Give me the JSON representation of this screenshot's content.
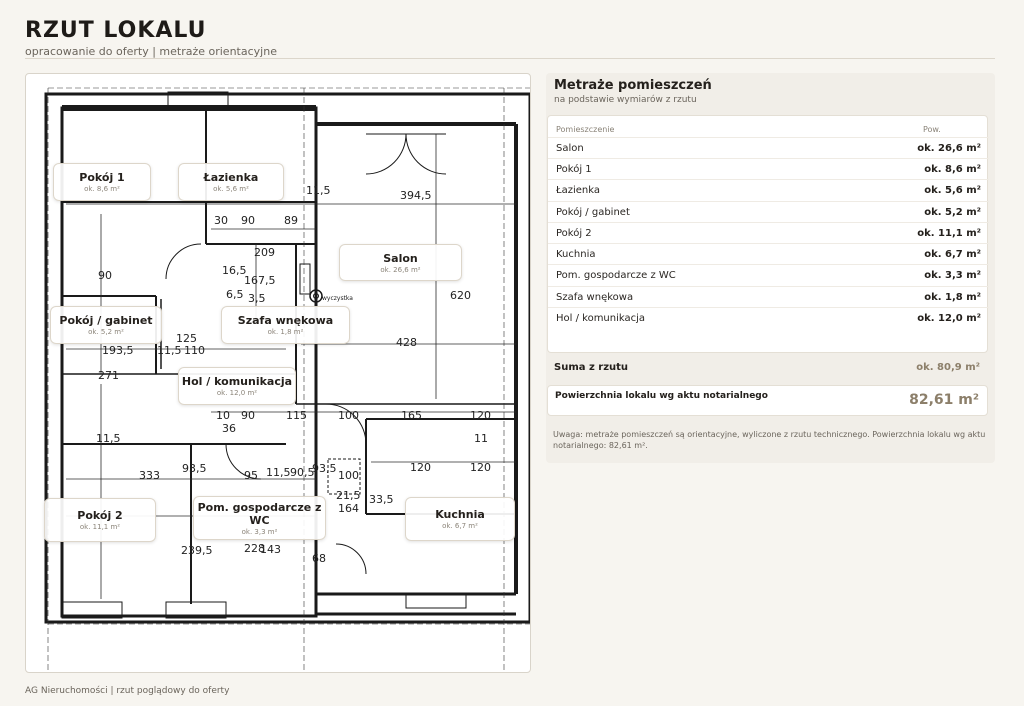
{
  "header": {
    "title": "RZUT LOKALU",
    "subtitle": "opracowanie do oferty | metraże orientacyjne"
  },
  "plan": {
    "rooms": [
      {
        "name": "Pokój 1",
        "area": "ok. 8,6 m²"
      },
      {
        "name": "Łazienka",
        "area": "ok. 5,6 m²"
      },
      {
        "name": "Salon",
        "area": "ok. 26,6 m²"
      },
      {
        "name": "Pokój / gabinet",
        "area": "ok. 5,2 m²"
      },
      {
        "name": "Szafa wnękowa",
        "area": "ok. 1,8 m²"
      },
      {
        "name": "Hol / komunikacja",
        "area": "ok. 12,0 m²"
      },
      {
        "name": "Pokój 2",
        "area": "ok. 11,1 m²"
      },
      {
        "name": "Pom. gospodarcze z WC",
        "area": "ok. 3,3 m²"
      },
      {
        "name": "Kuchnia",
        "area": "ok. 6,7 m²"
      }
    ],
    "dimensions": [
      "394,5",
      "11,5",
      "30",
      "90",
      "89",
      "209",
      "16,5",
      "167,5",
      "6,5",
      "3,5",
      "90",
      "428",
      "620",
      "193,5",
      "11,5",
      "125",
      "110",
      "271",
      "10",
      "90",
      "115",
      "100",
      "165",
      "120",
      "36",
      "11,5",
      "11",
      "333",
      "93,5",
      "95",
      "11,5",
      "90,5",
      "93,5",
      "100",
      "21,5",
      "120",
      "120",
      "33,5",
      "164",
      "239,5",
      "228",
      "143",
      "68"
    ],
    "annotation": "wyczystka"
  },
  "summary": {
    "title": "Metraże pomieszczeń",
    "subtitle": "na podstawie wymiarów z rzutu",
    "col_room": "Pomieszczenie",
    "col_area": "Pow.",
    "rows": [
      {
        "name": "Salon",
        "area": "ok. 26,6 m²"
      },
      {
        "name": "Pokój 1",
        "area": "ok. 8,6 m²"
      },
      {
        "name": "Łazienka",
        "area": "ok. 5,6 m²"
      },
      {
        "name": "Pokój / gabinet",
        "area": "ok. 5,2 m²"
      },
      {
        "name": "Pokój 2",
        "area": "ok. 11,1 m²"
      },
      {
        "name": "Kuchnia",
        "area": "ok. 6,7 m²"
      },
      {
        "name": "Pom. gospodarcze z WC",
        "area": "ok. 3,3 m²"
      },
      {
        "name": "Szafa wnękowa",
        "area": "ok. 1,8 m²"
      },
      {
        "name": "Hol / komunikacja",
        "area": "ok. 12,0 m²"
      }
    ],
    "sum_label": "Suma z rzutu",
    "sum_value": "ok. 80,9 m²",
    "notary_label": "Powierzchnia lokalu wg aktu notarialnego",
    "notary_value": "82,61 m²",
    "note": "Uwaga: metraże pomieszczeń są orientacyjne, wyliczone z rzutu technicznego. Powierzchnia lokalu wg aktu notarialnego: 82,61 m²."
  },
  "footer": "AG Nieruchomości | rzut poglądowy do oferty",
  "colors": {
    "background": "#f7f5f0",
    "accent": "#8c7f6a",
    "wall": "#1a1a1a",
    "dimension": "#2b2b2b"
  }
}
